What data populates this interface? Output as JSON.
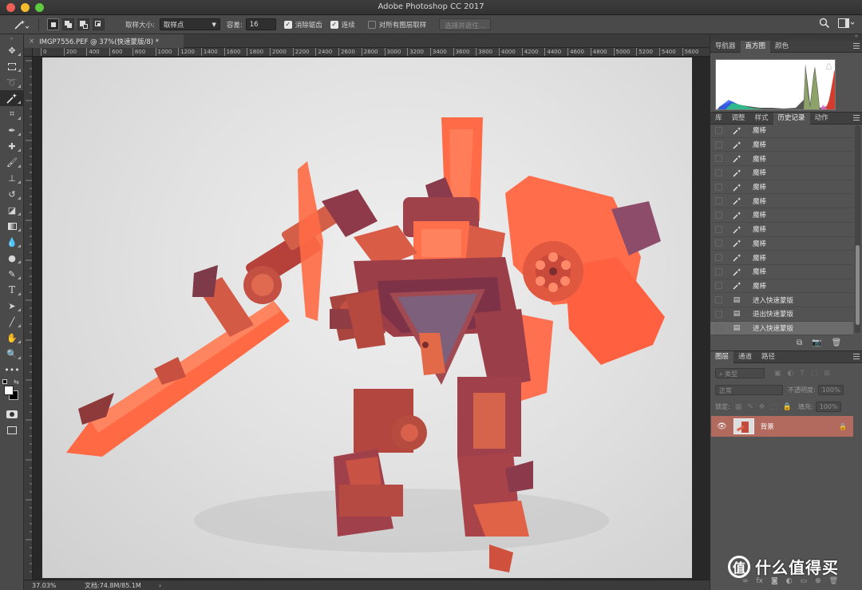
{
  "window": {
    "title": "Adobe Photoshop CC 2017",
    "traffic_lights": [
      "#ec5f57",
      "#f5bd2e",
      "#5fc93f"
    ]
  },
  "options_bar": {
    "tool_icon": "magic-wand-icon",
    "sample_size_label": "取样大小:",
    "sample_size_value": "取样点",
    "tolerance_label": "容差:",
    "tolerance_value": "16",
    "antialias_label": "消除锯齿",
    "antialias_checked": true,
    "contiguous_label": "连续",
    "contiguous_checked": true,
    "sample_all_layers_label": "对所有图层取样",
    "sample_all_layers_checked": false,
    "select_subject_button": "选择并遮住..."
  },
  "document": {
    "tab_title": "IMGP7556.PEF @ 37%(快速蒙版/8) *",
    "ruler_marks": [
      "0",
      "200",
      "400",
      "600",
      "800",
      "1000",
      "1200",
      "1400",
      "1600",
      "1800",
      "2000",
      "2200",
      "2400",
      "2600",
      "2800",
      "3000",
      "3200",
      "3400",
      "3600",
      "3800",
      "4000",
      "4200",
      "4400",
      "4600",
      "4800",
      "5000",
      "5200",
      "5400",
      "5600"
    ],
    "zoom": "37.03%",
    "doc_size": "文档:74.8M/85.1M"
  },
  "panels": {
    "top_tabs": [
      "导航器",
      "直方图",
      "颜色"
    ],
    "top_active": "直方图",
    "mid_tabs": [
      "库",
      "调整",
      "样式",
      "历史记录",
      "动作"
    ],
    "mid_active": "历史记录",
    "history": [
      {
        "label": "魔棒",
        "icon": "magic-wand-icon"
      },
      {
        "label": "魔棒",
        "icon": "magic-wand-icon"
      },
      {
        "label": "魔棒",
        "icon": "magic-wand-icon"
      },
      {
        "label": "魔棒",
        "icon": "magic-wand-icon"
      },
      {
        "label": "魔棒",
        "icon": "magic-wand-icon"
      },
      {
        "label": "魔棒",
        "icon": "magic-wand-icon"
      },
      {
        "label": "魔棒",
        "icon": "magic-wand-icon"
      },
      {
        "label": "魔棒",
        "icon": "magic-wand-icon"
      },
      {
        "label": "魔棒",
        "icon": "magic-wand-icon"
      },
      {
        "label": "魔棒",
        "icon": "magic-wand-icon"
      },
      {
        "label": "魔棒",
        "icon": "magic-wand-icon"
      },
      {
        "label": "魔棒",
        "icon": "magic-wand-icon"
      },
      {
        "label": "进入快速蒙版",
        "icon": "document-icon"
      },
      {
        "label": "退出快速蒙版",
        "icon": "document-icon"
      },
      {
        "label": "进入快速蒙版",
        "icon": "document-icon"
      }
    ],
    "layers_tabs": [
      "图层",
      "通道",
      "路径"
    ],
    "layers_active": "图层",
    "filter_kind": "类型",
    "blend_mode": "正常",
    "opacity_label": "不透明度:",
    "opacity_value": "100%",
    "lock_label": "锁定:",
    "fill_label": "填充:",
    "fill_value": "100%",
    "layer_name": "背景"
  },
  "watermark": "什么值得买",
  "colors": {
    "quick_mask_overlay": "#ff5a3c",
    "layer_selected": "#b26a5e"
  }
}
